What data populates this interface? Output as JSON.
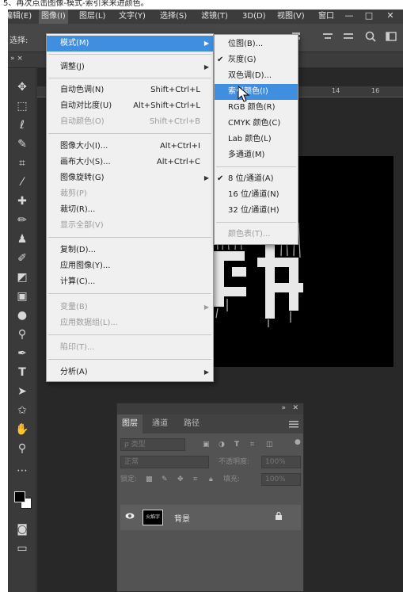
{
  "caption": "5、再次点击图像-模式-索引来来进颜色。",
  "menubar": {
    "items": [
      "编辑(E)",
      "图像(I)",
      "图层(L)",
      "文字(Y)",
      "选择(S)",
      "滤镜(T)",
      "3D(D)",
      "视图(V)",
      "窗口"
    ],
    "window_buttons": [
      "—",
      "□",
      "✕"
    ]
  },
  "options": {
    "select_label": "选择:"
  },
  "docbar": {
    "tab_left": "» ×"
  },
  "ruler_ticks": [
    "14",
    "16"
  ],
  "main_menu": {
    "mode": {
      "label": "模式(M)"
    },
    "adjust": {
      "label": "调整(J)"
    },
    "auto_tone": {
      "label": "自动色调(N)",
      "shortcut": "Shift+Ctrl+L"
    },
    "auto_contrast": {
      "label": "自动对比度(U)",
      "shortcut": "Alt+Shift+Ctrl+L"
    },
    "auto_color": {
      "label": "自动颜色(O)",
      "shortcut": "Shift+Ctrl+B"
    },
    "image_size": {
      "label": "图像大小(I)...",
      "shortcut": "Alt+Ctrl+I"
    },
    "canvas_size": {
      "label": "画布大小(S)...",
      "shortcut": "Alt+Ctrl+C"
    },
    "rotation": {
      "label": "图像旋转(G)"
    },
    "crop": {
      "label": "裁剪(P)"
    },
    "trim": {
      "label": "裁切(R)..."
    },
    "reveal_all": {
      "label": "显示全部(V)"
    },
    "duplicate": {
      "label": "复制(D)..."
    },
    "apply_image": {
      "label": "应用图像(Y)..."
    },
    "calculations": {
      "label": "计算(C)..."
    },
    "variables": {
      "label": "变量(B)"
    },
    "apply_data": {
      "label": "应用数据组(L)..."
    },
    "trap": {
      "label": "陷印(T)..."
    },
    "analysis": {
      "label": "分析(A)"
    }
  },
  "sub_menu": {
    "bitmap": "位图(B)...",
    "grayscale": "灰度(G)",
    "duotone": "双色调(D)...",
    "indexed": "索引颜色(I)",
    "rgb": "RGB 颜色(R)",
    "cmyk": "CMYK 颜色(C)",
    "lab": "Lab 颜色(L)",
    "multichannel": "多通道(M)",
    "bit8": "8 位/通道(A)",
    "bit16": "16 位/通道(N)",
    "bit32": "32 位/通道(H)",
    "color_table": "颜色表(T)..."
  },
  "layers_panel": {
    "tabs": [
      "图层",
      "通道",
      "路径"
    ],
    "search_placeholder": "ρ 类型",
    "blend_mode": "正常",
    "opacity_label": "不透明度:",
    "opacity_value": "100%",
    "lock_label": "锁定:",
    "fill_label": "填充:",
    "fill_value": "100%",
    "layer_name": "背景",
    "thumb_text": "火焰字"
  },
  "colors": {
    "menu_highlight": "#3f8ee0",
    "menu_bg": "#f0f0f0",
    "ps_bg": "#3a3a3a"
  }
}
